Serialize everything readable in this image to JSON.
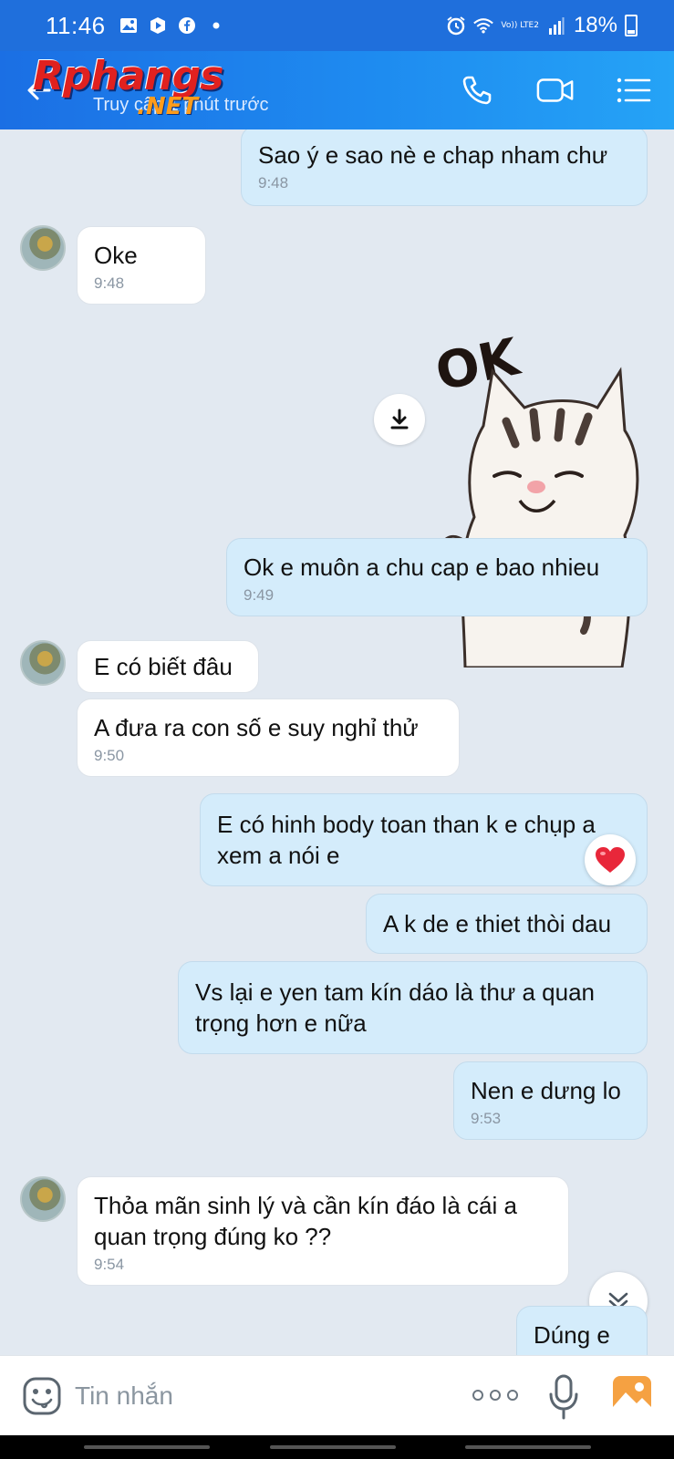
{
  "status_bar": {
    "time": "11:46",
    "battery": "18%",
    "network_label": "Vo)) LTE2"
  },
  "header": {
    "subtitle": "Truy cập 1 phút trước",
    "watermark": "Rphangs",
    "watermark_suffix": ".NET"
  },
  "messages": [
    {
      "direction": "out",
      "text": "Sao ý e sao nè e chap nham chư",
      "time": "9:48"
    },
    {
      "direction": "in",
      "text": "Oke",
      "time": "9:48"
    },
    {
      "direction": "out",
      "type": "sticker",
      "sticker_text": "OK"
    },
    {
      "direction": "out",
      "text": "Ok e muôn a chu cap e bao nhieu",
      "time": "9:49"
    },
    {
      "direction": "in",
      "text": "E có biết đâu",
      "time": ""
    },
    {
      "direction": "in",
      "text": "A đưa ra con số e suy nghỉ thử",
      "time": "9:50"
    },
    {
      "direction": "out",
      "text": "E có hinh body toan than k e chụp a xem a nói e",
      "time": ""
    },
    {
      "direction": "out",
      "text": "A k de e thiet thòi dau",
      "time": ""
    },
    {
      "direction": "out",
      "text": "Vs lại e yen tam kín dáo là thư a quan trọng hơn e nữa",
      "time": ""
    },
    {
      "direction": "out",
      "text": "Nen e dưng lo",
      "time": "9:53"
    },
    {
      "direction": "in",
      "text": "Thỏa mãn sinh lý và cần kín đáo là cái a quan trọng đúng ko ??",
      "time": "9:54"
    },
    {
      "direction": "out",
      "text": "Dúng e",
      "time": ""
    }
  ],
  "input": {
    "placeholder": "Tin nhắn"
  },
  "colors": {
    "header_blue": "#1e8bf0",
    "outgoing_bubble": "#d4ecfb",
    "incoming_bubble": "#ffffff",
    "chat_background": "#e2e9f1",
    "reaction_heart": "#e8273a",
    "photo_button": "#f5a142"
  },
  "icons": [
    "back-arrow-icon",
    "phone-icon",
    "video-call-icon",
    "menu-list-icon",
    "download-icon",
    "heart-icon",
    "chevron-double-down-icon",
    "emoji-icon",
    "more-dots-icon",
    "microphone-icon",
    "photo-icon"
  ]
}
